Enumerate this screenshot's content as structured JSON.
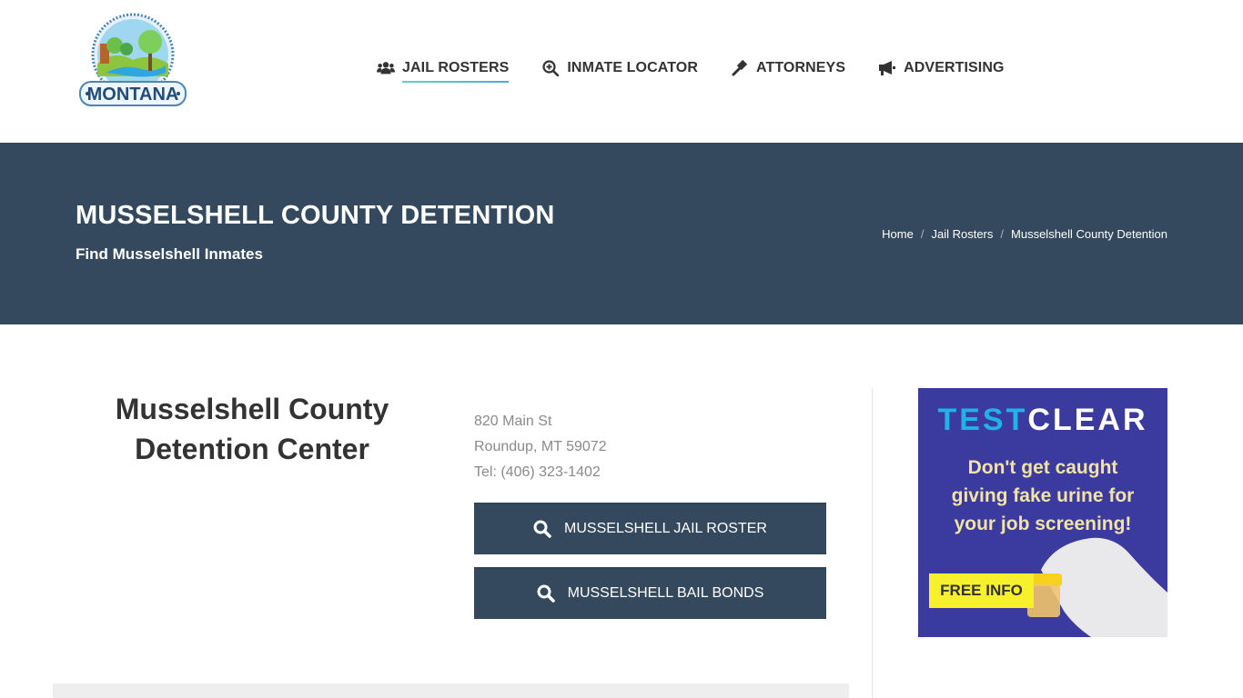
{
  "header": {
    "logo_text": "MONTANA",
    "nav": [
      {
        "label": "JAIL ROSTERS",
        "icon": "users-icon",
        "active": true
      },
      {
        "label": "INMATE LOCATOR",
        "icon": "search-plus-icon",
        "active": false
      },
      {
        "label": "ATTORNEYS",
        "icon": "gavel-icon",
        "active": false
      },
      {
        "label": "ADVERTISING",
        "icon": "megaphone-icon",
        "active": false
      }
    ],
    "accent": "#4fa9d8"
  },
  "titlebar": {
    "title": "MUSSELSHELL COUNTY DETENTION",
    "subtitle": "Find Musselshell Inmates",
    "background": "#34495e",
    "breadcrumb": [
      {
        "label": "Home"
      },
      {
        "label": "Jail Rosters"
      },
      {
        "label": "Musselshell County Detention"
      }
    ],
    "separator": "/"
  },
  "facility": {
    "name_line1": "Musselshell County",
    "name_line2": "Detention Center",
    "address_line1": "820 Main St",
    "address_line2": "Roundup, MT 59072",
    "phone": "Tel: (406) 323-1402"
  },
  "buttons": {
    "jail_roster": "MUSSELSHELL JAIL ROSTER",
    "bail_bonds": "MUSSELSHELL BAIL BONDS"
  },
  "ad": {
    "brand_part1": "TEST",
    "brand_part2": "CLEAR",
    "line1": "Don't get caught",
    "line2": "giving fake urine for",
    "line3": "your job screening!",
    "cta": "FREE INFO",
    "background": "#3b3a9e"
  }
}
